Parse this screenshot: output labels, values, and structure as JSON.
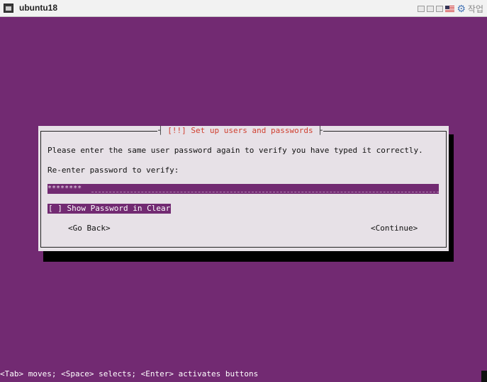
{
  "window": {
    "title": "ubuntu18",
    "menu_label": "작업"
  },
  "dialog": {
    "title_prefix": "[!!]",
    "title_text": "Set up users and passwords",
    "instruction": "Please enter the same user password again to verify you have typed it correctly.",
    "prompt": "Re-enter password to verify:",
    "password_value": "********",
    "checkbox_label": "[ ] Show Password in Clear",
    "back_button": "<Go Back>",
    "continue_button": "<Continue>"
  },
  "statusbar": {
    "help": "<Tab> moves; <Space> selects; <Enter> activates buttons"
  },
  "colors": {
    "background": "#722a72",
    "dialog": "#e7e1e7",
    "title": "#d04030"
  },
  "icons": [
    "window-icon",
    "settings-gear-icon",
    "us-flag-icon"
  ]
}
